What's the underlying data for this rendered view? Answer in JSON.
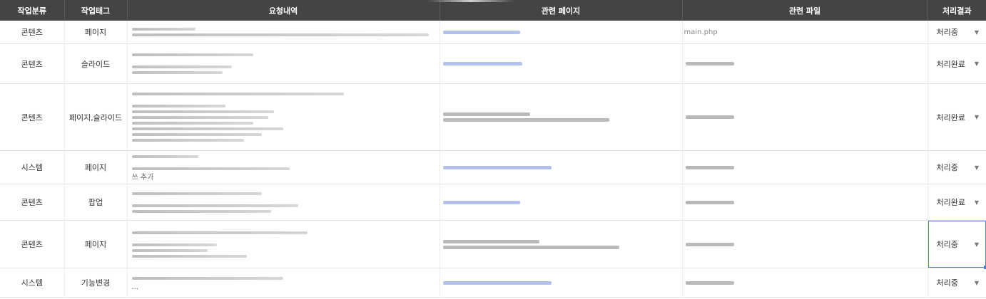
{
  "headers": {
    "category": "작업분류",
    "tag": "작업태그",
    "request": "요청내역",
    "page": "관련 페이지",
    "file": "관련 파일",
    "result": "처리결과"
  },
  "rows": [
    {
      "category": "콘텐츠",
      "tag": "페이지",
      "result": "처리중",
      "req_lines": [
        0.21,
        0.98
      ],
      "req_text": "",
      "links": [
        0.32
      ],
      "file": "main.php",
      "files": [
        0.0
      ]
    },
    {
      "category": "콘텐츠",
      "tag": "슬라이드",
      "result": "처리완료",
      "req_lines": [
        0.4,
        null,
        0.33,
        0.3
      ],
      "req_text": "",
      "links": [
        0.33
      ],
      "file": "",
      "files": [
        0.2
      ]
    },
    {
      "category": "콘텐츠",
      "tag": "페이지,슬라이드",
      "result": "처리완료",
      "req_lines": [
        0.7,
        null,
        0.31,
        0.47,
        0.45,
        0.4,
        0.5,
        0.43,
        0.37
      ],
      "req_text": "",
      "links": [
        0.36,
        0.69
      ],
      "file": "",
      "files": [
        0.2
      ]
    },
    {
      "category": "시스템",
      "tag": "페이지",
      "result": "처리중",
      "req_lines": [
        0.22,
        null,
        0.52
      ],
      "req_text": "쓰 추가",
      "links": [
        0.45
      ],
      "file": "",
      "files": [
        0.2
      ]
    },
    {
      "category": "콘텐츠",
      "tag": "팝업",
      "result": "처리완료",
      "req_lines": [
        0.43,
        null,
        0.55,
        0.46
      ],
      "req_text": "",
      "links": [
        0.32
      ],
      "file": "",
      "files": [
        0.2
      ]
    },
    {
      "category": "콘텐츠",
      "tag": "페이지",
      "result": "처리중",
      "req_lines": [
        0.58,
        null,
        0.28,
        0.25,
        0.38
      ],
      "req_text": "",
      "links": [
        0.4,
        0.73
      ],
      "file": "",
      "files": [
        0.2
      ]
    },
    {
      "category": "시스템",
      "tag": "기능변경",
      "result": "처리중",
      "req_lines": [
        0.5
      ],
      "req_text": "...",
      "links": [
        0.45
      ],
      "file": "",
      "files": [
        0.2
      ]
    }
  ],
  "focused_row": 5
}
